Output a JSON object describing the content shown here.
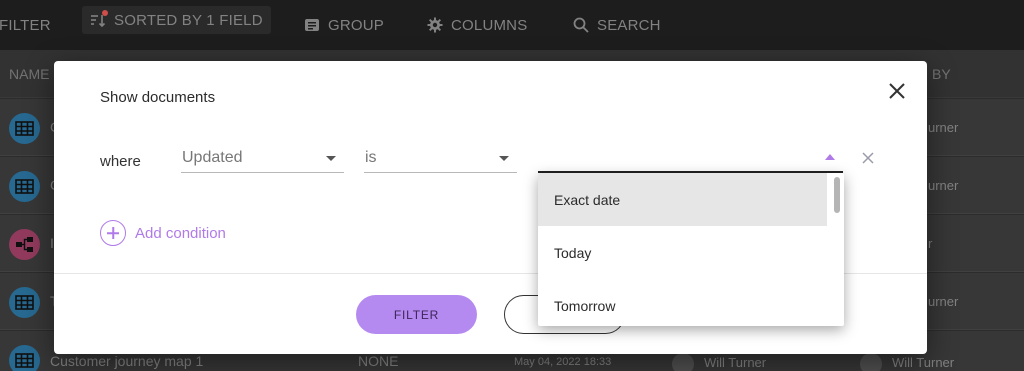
{
  "toolbar": {
    "filter_label": "FILTER",
    "sorted_label": "SORTED BY 1 FIELD",
    "group_label": "GROUP",
    "columns_label": "COLUMNS",
    "search_label": "SEARCH"
  },
  "table": {
    "headers": [
      "NAME",
      "BY"
    ],
    "rows": [
      {
        "name": "C",
        "icon": "grid-icon",
        "color": "#2a6f99",
        "owner": "urner"
      },
      {
        "name": "C",
        "icon": "grid-icon",
        "color": "#2a6f99",
        "owner": "urner"
      },
      {
        "name": "I",
        "icon": "flow-icon",
        "color": "#9a3e63",
        "owner": "r"
      },
      {
        "name": "T",
        "icon": "grid-icon",
        "color": "#2a6f99",
        "owner": "urner"
      },
      {
        "name": "Customer journey map 1",
        "icon": "grid-icon",
        "color": "#2a6f99",
        "share": "NONE",
        "date": "May 04, 2022 18:33",
        "author": "Will Turner",
        "owner": "Will Turner"
      }
    ]
  },
  "modal": {
    "title": "Show documents",
    "where_label": "where",
    "field_select": "Updated",
    "operator_select": "is",
    "value_placeholder": "",
    "add_condition_label": "Add condition",
    "filter_button": "FILTER",
    "second_button": ""
  },
  "dropdown": {
    "options": [
      "Exact date",
      "Today",
      "Tomorrow"
    ],
    "highlighted": "Exact date"
  },
  "colors": {
    "accent": "#b07ae8",
    "button_fill": "#b58af0"
  }
}
